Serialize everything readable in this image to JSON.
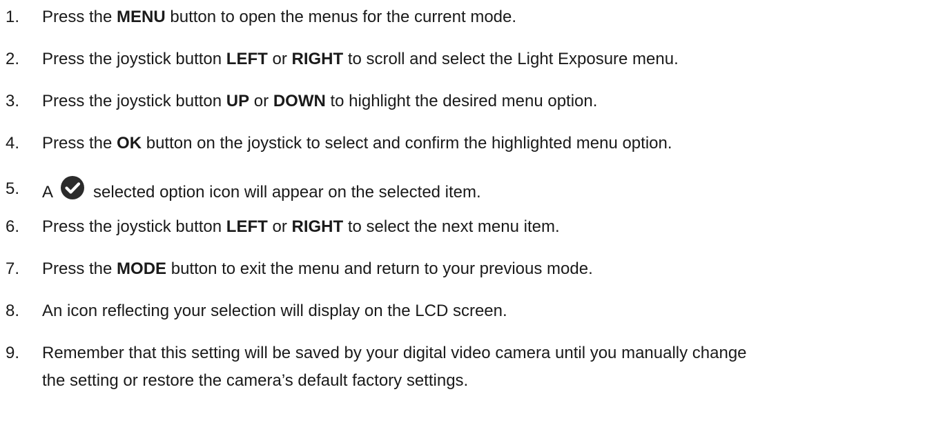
{
  "steps": [
    {
      "num": "1.",
      "pre": "Press the ",
      "bold1": "MENU",
      "post": " button to open the menus for the current mode."
    },
    {
      "num": "2.",
      "pre": "Press the joystick button ",
      "bold1": "LEFT",
      "mid": " or ",
      "bold2": "RIGHT",
      "post": " to scroll and select the Light Exposure menu."
    },
    {
      "num": "3.",
      "pre": "Press the joystick button ",
      "bold1": "UP",
      "mid": " or ",
      "bold2": "DOWN",
      "post": " to highlight the desired menu option."
    },
    {
      "num": "4.",
      "pre": "Press the ",
      "bold1": "OK",
      "post": " button on the joystick to select and confirm the highlighted menu option."
    },
    {
      "num": "5.",
      "pre": "A",
      "post": "selected option icon will appear on the selected item.",
      "icon": "check-circle-icon"
    },
    {
      "num": "6.",
      "pre": "Press the joystick button ",
      "bold1": "LEFT",
      "mid": " or ",
      "bold2": "RIGHT",
      "post": " to select the next menu item."
    },
    {
      "num": "7.",
      "pre": "Press the ",
      "bold1": "MODE",
      "post": " button to exit the menu and return to your previous mode."
    },
    {
      "num": "8.",
      "text": "An icon reflecting your selection will display on the LCD screen."
    },
    {
      "num": "9.",
      "line1": "Remember that this setting will be saved by your digital video camera until you manually change",
      "line2": "the setting or restore the camera’s default factory settings."
    }
  ],
  "colors": {
    "text": "#1a1a1a",
    "icon_fill": "#2b2b2b",
    "icon_mark": "#ffffff"
  }
}
